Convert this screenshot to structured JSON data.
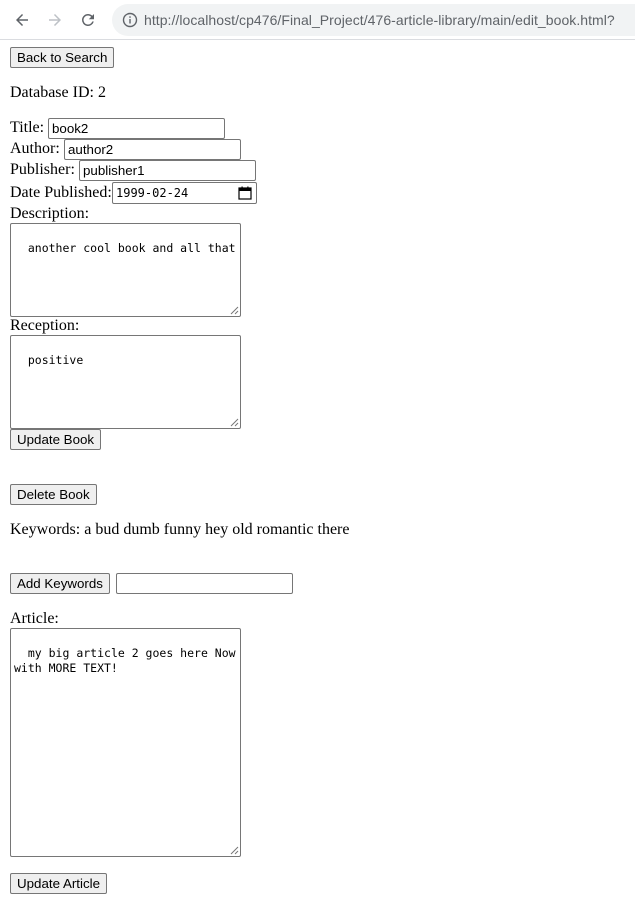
{
  "browser": {
    "url": "http://localhost/cp476/Final_Project/476-article-library/main/edit_book.html?"
  },
  "page": {
    "back_button": "Back to Search",
    "database_id": "Database ID: 2",
    "fields": {
      "title_label": "Title:",
      "title_value": "book2",
      "author_label": "Author:",
      "author_value": "author2",
      "publisher_label": "Publisher:",
      "publisher_value": "publisher1",
      "date_label": "Date Published:",
      "date_value": "1999-02-24",
      "description_label": "Description:",
      "description_value": "another cool book and all that",
      "reception_label": "Reception:",
      "reception_value": "positive"
    },
    "update_book_button": "Update Book",
    "delete_book_button": "Delete Book",
    "keywords_text": "Keywords: a bud dumb funny hey old romantic there",
    "add_keywords_button": "Add Keywords",
    "keywords_input_value": "",
    "article_label": "Article:",
    "article_value": "my big article 2 goes here Now with MORE TEXT!",
    "update_article_button": "Update Article"
  }
}
